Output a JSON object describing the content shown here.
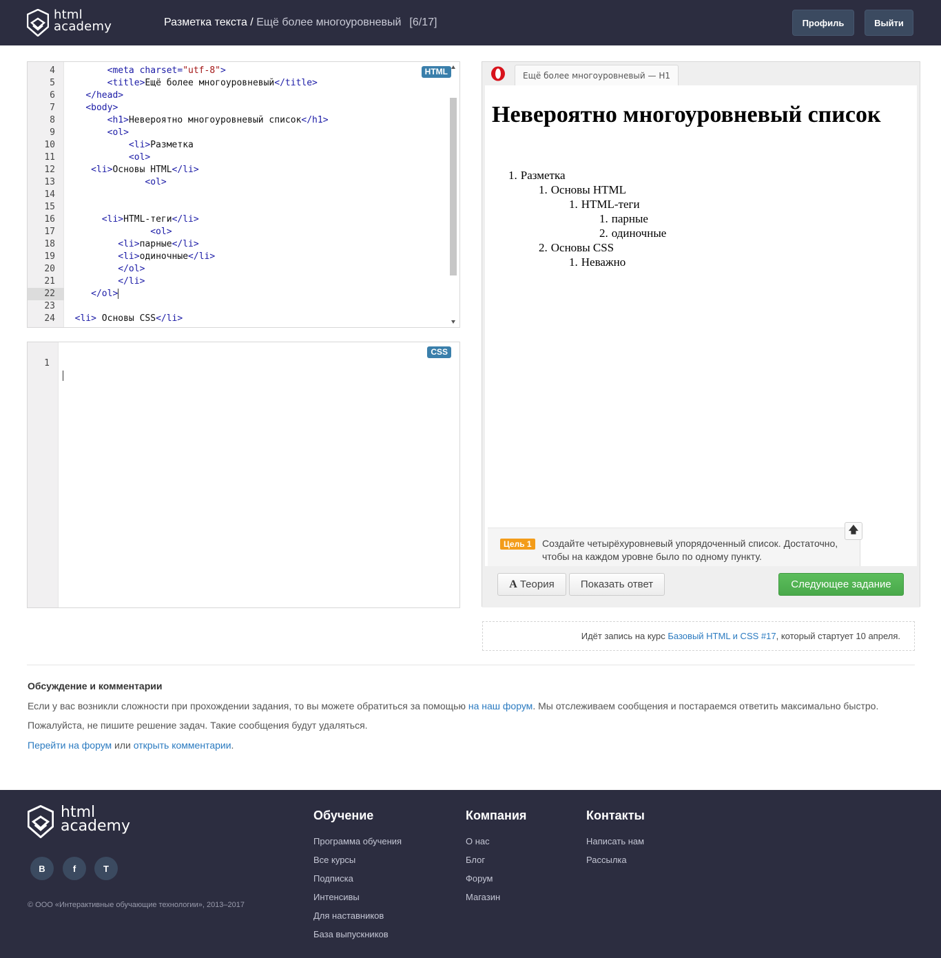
{
  "header": {
    "logo_line1": "html",
    "logo_line2": "academy",
    "breadcrumb_section": "Разметка текста",
    "breadcrumb_sep": " / ",
    "breadcrumb_task": "Ещё более многоуровневый",
    "counter": "[6/17]",
    "profile_label": "Профиль",
    "logout_label": "Выйти"
  },
  "html_editor": {
    "badge": "HTML",
    "lines": [
      {
        "n": "4",
        "indent": "        ",
        "parts": [
          [
            "t",
            "<meta charset="
          ],
          [
            "s",
            "\"utf-8\""
          ],
          [
            "t",
            ">"
          ]
        ]
      },
      {
        "n": "5",
        "indent": "        ",
        "parts": [
          [
            "t",
            "<title>"
          ],
          [
            "x",
            "Ещё более многоуровневый"
          ],
          [
            "t",
            "</title>"
          ]
        ]
      },
      {
        "n": "6",
        "indent": "    ",
        "parts": [
          [
            "t",
            "</head>"
          ]
        ]
      },
      {
        "n": "7",
        "indent": "    ",
        "parts": [
          [
            "t",
            "<body>"
          ]
        ]
      },
      {
        "n": "8",
        "indent": "        ",
        "parts": [
          [
            "t",
            "<h1>"
          ],
          [
            "x",
            "Невероятно многоуровневый список"
          ],
          [
            "t",
            "</h1>"
          ]
        ]
      },
      {
        "n": "9",
        "indent": "        ",
        "parts": [
          [
            "t",
            "<ol>"
          ]
        ]
      },
      {
        "n": "10",
        "indent": "            ",
        "parts": [
          [
            "t",
            "<li>"
          ],
          [
            "x",
            "Разметка"
          ]
        ]
      },
      {
        "n": "11",
        "indent": "            ",
        "parts": [
          [
            "t",
            "<ol>"
          ]
        ]
      },
      {
        "n": "12",
        "indent": "     ",
        "parts": [
          [
            "t",
            "<li>"
          ],
          [
            "x",
            "Основы HTML"
          ],
          [
            "t",
            "</li>"
          ]
        ]
      },
      {
        "n": "13",
        "indent": "               ",
        "parts": [
          [
            "t",
            "<ol>"
          ]
        ]
      },
      {
        "n": "14",
        "indent": "",
        "parts": []
      },
      {
        "n": "15",
        "indent": "",
        "parts": []
      },
      {
        "n": "16",
        "indent": "       ",
        "parts": [
          [
            "t",
            "<li>"
          ],
          [
            "x",
            "HTML-теги"
          ],
          [
            "t",
            "</li>"
          ]
        ]
      },
      {
        "n": "17",
        "indent": "                ",
        "parts": [
          [
            "t",
            "<ol>"
          ]
        ]
      },
      {
        "n": "18",
        "indent": "          ",
        "parts": [
          [
            "t",
            "<li>"
          ],
          [
            "x",
            "парные"
          ],
          [
            "t",
            "</li>"
          ]
        ]
      },
      {
        "n": "19",
        "indent": "          ",
        "parts": [
          [
            "t",
            "<li>"
          ],
          [
            "x",
            "одиночные"
          ],
          [
            "t",
            "</li>"
          ]
        ]
      },
      {
        "n": "20",
        "indent": "          ",
        "parts": [
          [
            "t",
            "</ol>"
          ]
        ]
      },
      {
        "n": "21",
        "indent": "          ",
        "parts": [
          [
            "t",
            "</li>"
          ]
        ]
      },
      {
        "n": "22",
        "indent": "     ",
        "parts": [
          [
            "t",
            "</ol>"
          ]
        ],
        "active": true
      },
      {
        "n": "23",
        "indent": "",
        "parts": []
      },
      {
        "n": "24",
        "indent": "  ",
        "parts": [
          [
            "t",
            "<li>"
          ],
          [
            "x",
            " Основы CSS"
          ],
          [
            "t",
            "</li>"
          ]
        ]
      }
    ]
  },
  "css_editor": {
    "badge": "CSS",
    "line_number": "1"
  },
  "preview": {
    "tab_title": "Ещё более многоуровневый — H1",
    "heading": "Невероятно многоуровневый список",
    "list": [
      {
        "marker": "1.",
        "text": "Разметка",
        "level": 0
      },
      {
        "marker": "1.",
        "text": "Основы HTML",
        "level": 1
      },
      {
        "marker": "1.",
        "text": "HTML-теги",
        "level": 2
      },
      {
        "marker": "1.",
        "text": "парные",
        "level": 3
      },
      {
        "marker": "2.",
        "text": "одиночные",
        "level": 3
      },
      {
        "marker": "2.",
        "text": "Основы CSS",
        "level": 1
      },
      {
        "marker": "1.",
        "text": "Неважно",
        "level": 2
      }
    ],
    "goal_badge": "Цель 1",
    "goal_text": "Создайте четырёхуровневый упорядоченный список. Достаточно, чтобы на каждом уровне было по одному пункту.",
    "goal_toggle": "🡅",
    "theory_icon": "A",
    "theory_label": "Теория",
    "answer_label": "Показать ответ",
    "next_label": "Следующее задание"
  },
  "enrolment": {
    "prefix": "Идёт запись на курс ",
    "course_link": "Базовый HTML и CSS #17",
    "suffix": ", который стартует 10 апреля."
  },
  "discussion": {
    "title": "Обсуждение и комментарии",
    "p1_before": "Если у вас возникли сложности при прохождении задания, то вы можете обратиться за помощью ",
    "p1_link": "на наш форум",
    "p1_after": ". Мы отслеживаем сообщения и постараемся ответить максимально быстро.",
    "p2": "Пожалуйста, не пишите решение задач. Такие сообщения будут удаляться.",
    "forum_link": "Перейти на форум",
    "or": " или ",
    "comments_link": "открыть комментарии",
    "dot": "."
  },
  "footer": {
    "logo_line1": "html",
    "logo_line2": "academy",
    "social": [
      "В",
      "f",
      "T"
    ],
    "copyright": "© ООО «Интерактивные обучающие технологии», 2013–2017",
    "columns": [
      {
        "title": "Обучение",
        "items": [
          "Программа обучения",
          "Все курсы",
          "Подписка",
          "Интенсивы",
          "Для наставников",
          "База выпускников"
        ]
      },
      {
        "title": "Компания",
        "items": [
          "О нас",
          "Блог",
          "Форум",
          "Магазин"
        ]
      },
      {
        "title": "Контакты",
        "items": [
          "Написать нам",
          "Рассылка"
        ]
      }
    ]
  },
  "colors": {
    "header_bg": "#2c2d40",
    "accent_link": "#2a7ac0",
    "next_button": "#4cae4c",
    "goal_badge": "#f39c1a"
  }
}
